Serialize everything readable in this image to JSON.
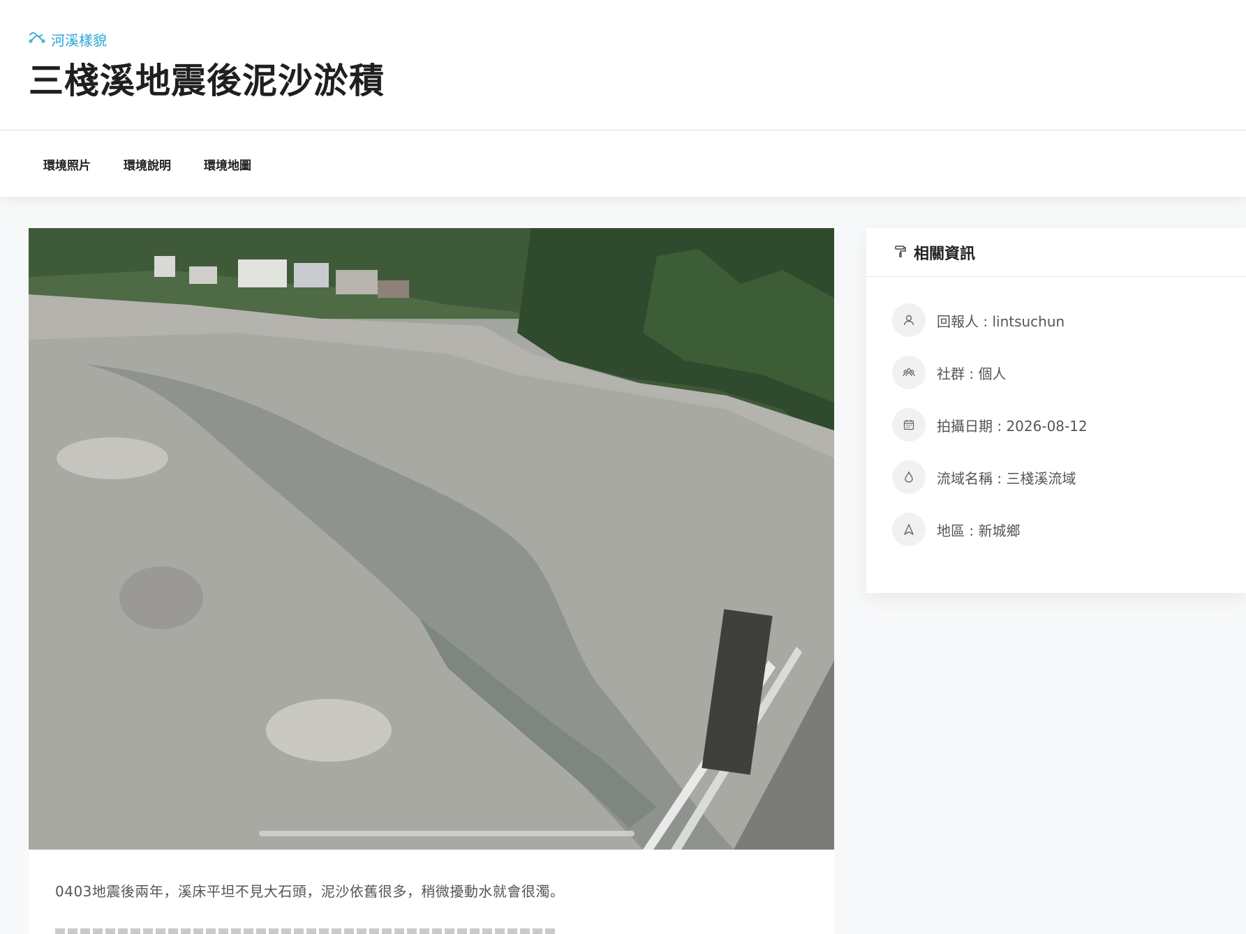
{
  "header": {
    "category": "河溪樣貌",
    "title": "三棧溪地震後泥沙淤積"
  },
  "tabs": [
    {
      "label": "環境照片"
    },
    {
      "label": "環境說明"
    },
    {
      "label": "環境地圖"
    }
  ],
  "photo": {
    "alt_subject": "riverbed with gravel and shallow stream"
  },
  "description": {
    "text": "0403地震後兩年，溪床平坦不見大石頭，泥沙依舊很多，稍微擾動水就會很濁。"
  },
  "info": {
    "title": "相關資訊",
    "items": [
      {
        "icon": "user-icon",
        "text": "回報人 : lintsuchun"
      },
      {
        "icon": "group-icon",
        "text": "社群 : 個人"
      },
      {
        "icon": "calendar-icon",
        "text": "拍攝日期 : 2026-08-12"
      },
      {
        "icon": "water-drop-icon",
        "text": "流域名稱 : 三棧溪流域"
      },
      {
        "icon": "navigation-icon",
        "text": "地區 : 新城鄉"
      }
    ]
  },
  "colors": {
    "accent": "#2aa6d8",
    "title": "#1f1f1f",
    "background": "#f7f8f9"
  }
}
